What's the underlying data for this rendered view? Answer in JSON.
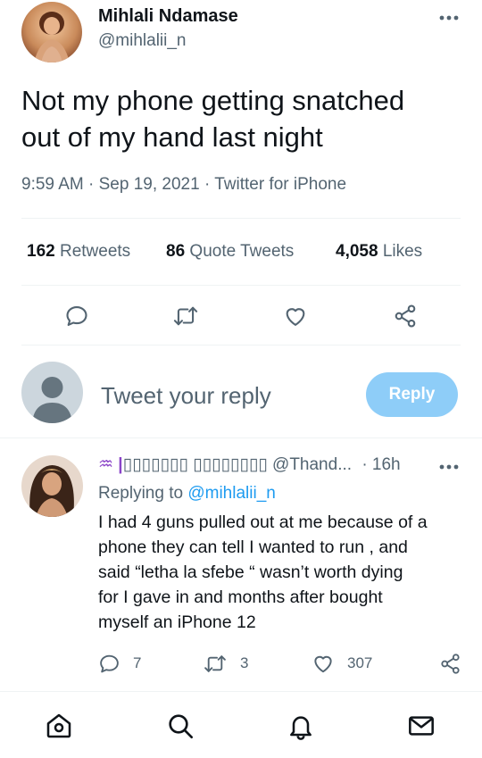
{
  "tweet": {
    "author_name": "Mihlali Ndamase",
    "author_handle": "@mihlalii_n",
    "text_line1": "Not my phone getting snatched",
    "text_line2": "out of my hand last night",
    "time": "9:59 AM",
    "sep": "·",
    "date": "Sep 19, 2021",
    "source": "Twitter for iPhone"
  },
  "stats": {
    "retweets_count": "162",
    "retweets_label": "Retweets",
    "quotes_count": "86",
    "quotes_label": "Quote Tweets",
    "likes_count": "4,058",
    "likes_label": "Likes"
  },
  "composer": {
    "placeholder": "Tweet your reply",
    "button_label": "Reply"
  },
  "reply": {
    "name_prefix": "♒ |",
    "name_text": "▯▯▯▯▯▯▯ ▯▯▯▯▯▯▯▯ @Thand...",
    "time": "· 16h",
    "replying_to_label": "Replying to",
    "replying_to_handle": "@mihlalii_n",
    "lines": [
      "I had 4 guns pulled out at me because of a",
      "phone they can tell I wanted to run , and",
      "said “letha la sfebe “ wasn’t worth dying",
      "for I gave in and months after bought",
      "myself an iPhone 12"
    ],
    "reply_count": "7",
    "retweet_count": "3",
    "like_count": "307"
  },
  "icons": {
    "more": "more-horizontal-icon",
    "reply": "comment-icon",
    "retweet": "retweet-icon",
    "like": "heart-icon",
    "share": "share-icon",
    "home": "home-icon",
    "search": "search-icon",
    "notifications": "bell-icon",
    "messages": "envelope-icon"
  },
  "colors": {
    "accent": "#1d9bf0",
    "reply_button_bg": "#8ecdf8",
    "muted_text": "#536471",
    "divider": "#eff3f4"
  }
}
